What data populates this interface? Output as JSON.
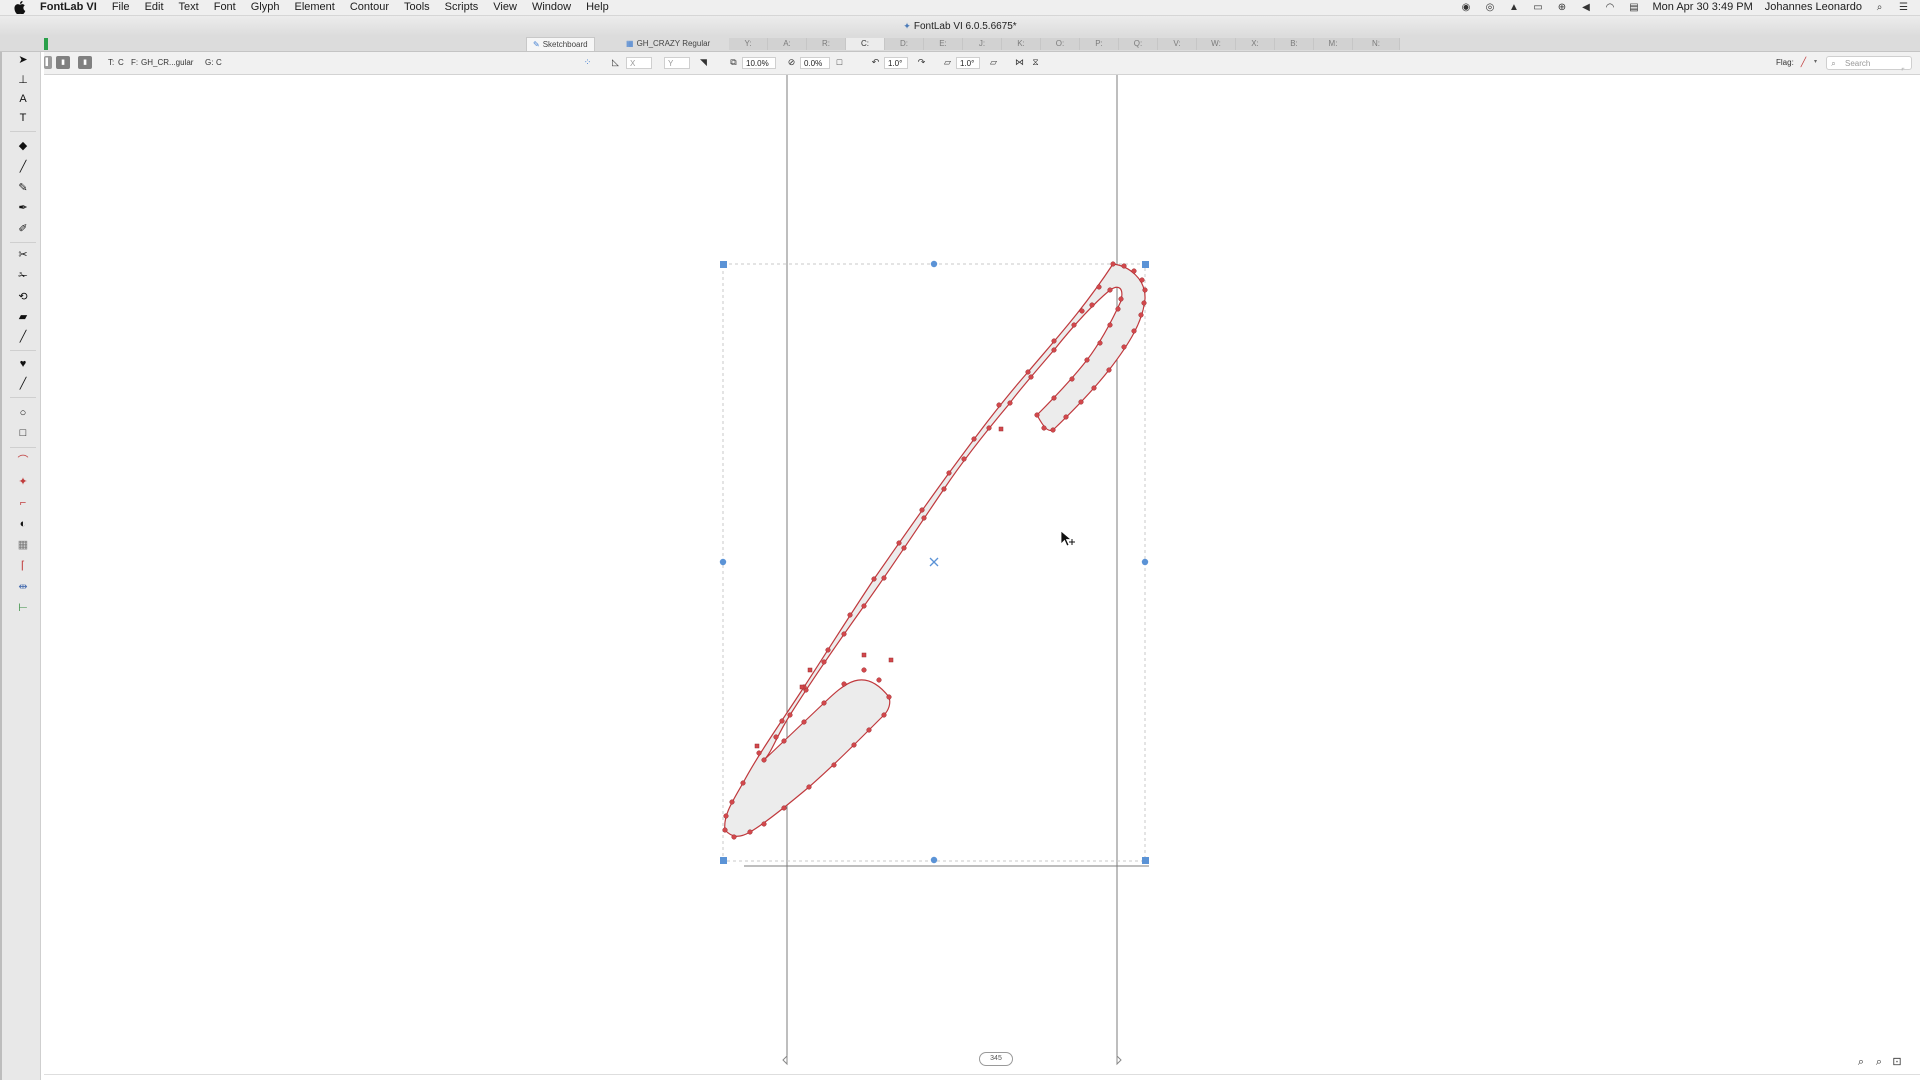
{
  "menubar": {
    "app_name": "FontLab VI",
    "items": [
      "File",
      "Edit",
      "Text",
      "Font",
      "Glyph",
      "Element",
      "Contour",
      "Tools",
      "Scripts",
      "View",
      "Window",
      "Help"
    ],
    "status_icons": [
      "record-icon",
      "creative-cloud-icon",
      "drive-icon",
      "airplay-icon",
      "network-icon",
      "volume-icon",
      "wifi-icon",
      "calendar-icon"
    ],
    "clock": "Mon Apr 30  3:49 PM",
    "user": "Johannes Leonardo"
  },
  "window": {
    "title": "FontLab VI 6.0.5.6675*",
    "tabs": {
      "sketchboard": "Sketchboard",
      "font": "GH_CRAZY Regular",
      "glyphs": [
        "Y:",
        "A:",
        "R:",
        "C:",
        "D:",
        "E:",
        "J:",
        "K:",
        "O:",
        "P:",
        "Q:",
        "V:",
        "W:",
        "X:",
        "B:",
        "M:",
        "N:"
      ]
    }
  },
  "propbar": {
    "type_label": "T:",
    "type_value": "C",
    "font_label": "F:",
    "font_value": "GH_CR...gular",
    "glyph_label": "G:",
    "glyph_value": "C",
    "x_placeholder": "X",
    "y_placeholder": "Y",
    "scale_value": "10.0%",
    "slant_value": "0.0%",
    "rotate_value": "1.0°",
    "skew_value": "1.0°",
    "flag_label": "Flag:",
    "search_placeholder": "Search"
  },
  "canvas": {
    "advance_width": "345",
    "accent_color": "#d2484c",
    "selection_color": "#5b93d6"
  }
}
